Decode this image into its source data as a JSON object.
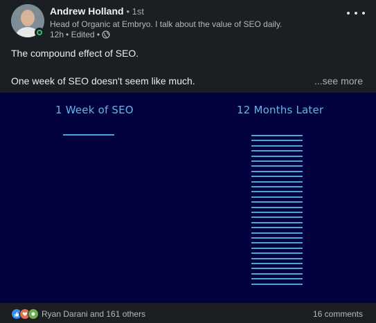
{
  "author": {
    "name": "Andrew Holland",
    "degree": "• 1st",
    "headline": "Head of Organic at Embryo. I talk about the value of SEO daily.",
    "time": "12h",
    "edited": "• Edited •"
  },
  "post": {
    "line1": "The compound effect of SEO.",
    "line2": "One week of SEO doesn't seem like much.",
    "see_more": "...see more"
  },
  "image": {
    "left_label": "1 Week of SEO",
    "right_label": "12 Months Later",
    "left_bar_count": 1,
    "right_bar_count": 30,
    "bar_color": "#4fa7d8",
    "background": "#02023f",
    "label_color": "#5fb8e6"
  },
  "footer": {
    "reactions_text": "Ryan Darani and 161 others",
    "comments": "16 comments",
    "reaction_icons": [
      "like-icon",
      "love-icon",
      "support-icon"
    ]
  }
}
